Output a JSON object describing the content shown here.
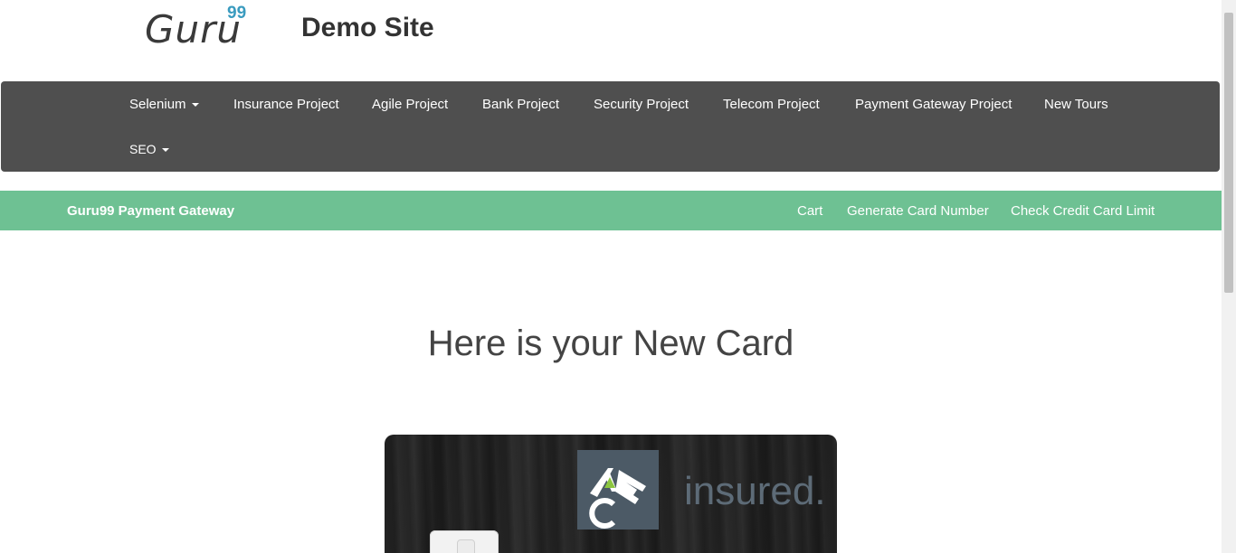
{
  "header": {
    "logo_text": "Guru",
    "logo_sup": "99",
    "site_title": "Demo Site"
  },
  "navbar": {
    "items": [
      {
        "label": "Selenium",
        "dropdown": true
      },
      {
        "label": "Insurance Project",
        "dropdown": false
      },
      {
        "label": "Agile Project",
        "dropdown": false
      },
      {
        "label": "Bank Project",
        "dropdown": false
      },
      {
        "label": "Security Project",
        "dropdown": false
      },
      {
        "label": "Telecom Project",
        "dropdown": false
      },
      {
        "label": "Payment Gateway Project",
        "dropdown": false
      },
      {
        "label": "New Tours",
        "dropdown": false
      },
      {
        "label": "SEO",
        "dropdown": true
      }
    ]
  },
  "subnav": {
    "brand": "Guru99 Payment Gateway",
    "links": [
      "Cart",
      "Generate Card Number",
      "Check Credit Card Limit"
    ]
  },
  "main": {
    "heading": "Here is your New Card",
    "card": {
      "brand_text": "insured.",
      "logo_letters": "ACE"
    }
  },
  "colors": {
    "navbar_bg": "#4f4f4f",
    "subnav_bg": "#6ec193",
    "logo_accent": "#3a9bbf"
  }
}
